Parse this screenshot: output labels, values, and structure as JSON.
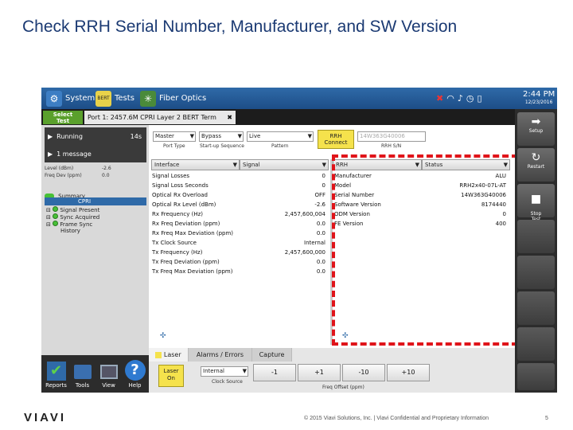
{
  "slide": {
    "title": "Check RRH Serial Number, Manufacturer, and SW Version",
    "footer_text": "© 2015 Viavi Solutions, Inc. | Viavi Confidential and Proprietary Information",
    "page_number": "5",
    "logo": "VIAVI"
  },
  "device": {
    "topbar": {
      "system_label": "System",
      "tests_label": "Tests",
      "fiber_label": "Fiber Optics",
      "time": "2:44 PM",
      "date": "12/23/2016"
    },
    "select_test_label": "Select\nTest",
    "port_tab_label": "Port 1: 2457.6M CPRI Layer 2 BERT Term",
    "left": {
      "running_label": "Running",
      "running_time": "14s",
      "message_label": "1 message",
      "stats": [
        {
          "label": "Level (dBm)",
          "value": "-2.6"
        },
        {
          "label": "Freq Dev (ppm)",
          "value": "0.0"
        }
      ],
      "summary_label": "Summary",
      "tree": [
        "CPRI",
        "Signal Present",
        "Sync Acquired",
        "Frame Sync",
        "History"
      ]
    },
    "controls": {
      "fort_type": "Master",
      "fort_type_label": "Port Type",
      "startup_seq": "Bypass",
      "startup_seq_label": "Start-up Sequence",
      "pattern": "Live",
      "pattern_label": "Pattern",
      "rrh_button": "RRH\nConnect",
      "rrh_id": "14W363G40006",
      "rrh_id_label": "RRH S/N"
    },
    "left_table": {
      "col1": "Interface",
      "col2": "Signal",
      "rows": [
        {
          "name": "Signal Losses",
          "value": "0"
        },
        {
          "name": "Signal Loss Seconds",
          "value": "0"
        },
        {
          "name": "Optical Rx Overload",
          "value": "OFF"
        },
        {
          "name": "Optical Rx Level (dBm)",
          "value": "-2.6"
        },
        {
          "name": "Rx Frequency (Hz)",
          "value": "2,457,600,004"
        },
        {
          "name": "Rx Freq Deviation (ppm)",
          "value": "0.0"
        },
        {
          "name": "Rx Freq Max Deviation (ppm)",
          "value": "0.0"
        },
        {
          "name": "Tx Clock Source",
          "value": "Internal"
        },
        {
          "name": "Tx Frequency (Hz)",
          "value": "2,457,600,000"
        },
        {
          "name": "Tx Freq Deviation (ppm)",
          "value": "0.0"
        },
        {
          "name": "Tx Freq Max Deviation (ppm)",
          "value": "0.0"
        }
      ]
    },
    "right_table": {
      "col1": "RRH",
      "col2": "Status",
      "rows": [
        {
          "name": "Manufacturer",
          "value": "ALU"
        },
        {
          "name": "Model",
          "value": "RRH2x40-07L-AT"
        },
        {
          "name": "Serial Number",
          "value": "14W363G40006"
        },
        {
          "name": "Software Version",
          "value": "8174440"
        },
        {
          "name": "ODM Version",
          "value": "0"
        },
        {
          "name": "FE Version",
          "value": "400"
        }
      ]
    },
    "bottom": {
      "tabs": [
        "Laser",
        "Alarms / Errors",
        "Capture"
      ],
      "laser_button": "Laser\nOn",
      "clock_source": "Internal",
      "clock_source_label": "Clock Source",
      "offsets": [
        "-1",
        "+1",
        "-10",
        "+10"
      ],
      "offset_label": "Freq Offset (ppm)"
    },
    "right_buttons": [
      {
        "icon": "➡",
        "label": "Setup"
      },
      {
        "icon": "↻",
        "label": "Restart"
      },
      {
        "icon": "■",
        "label": "Stop\nTest"
      }
    ],
    "dock": [
      "Reports",
      "Tools",
      "View",
      "Help"
    ]
  }
}
